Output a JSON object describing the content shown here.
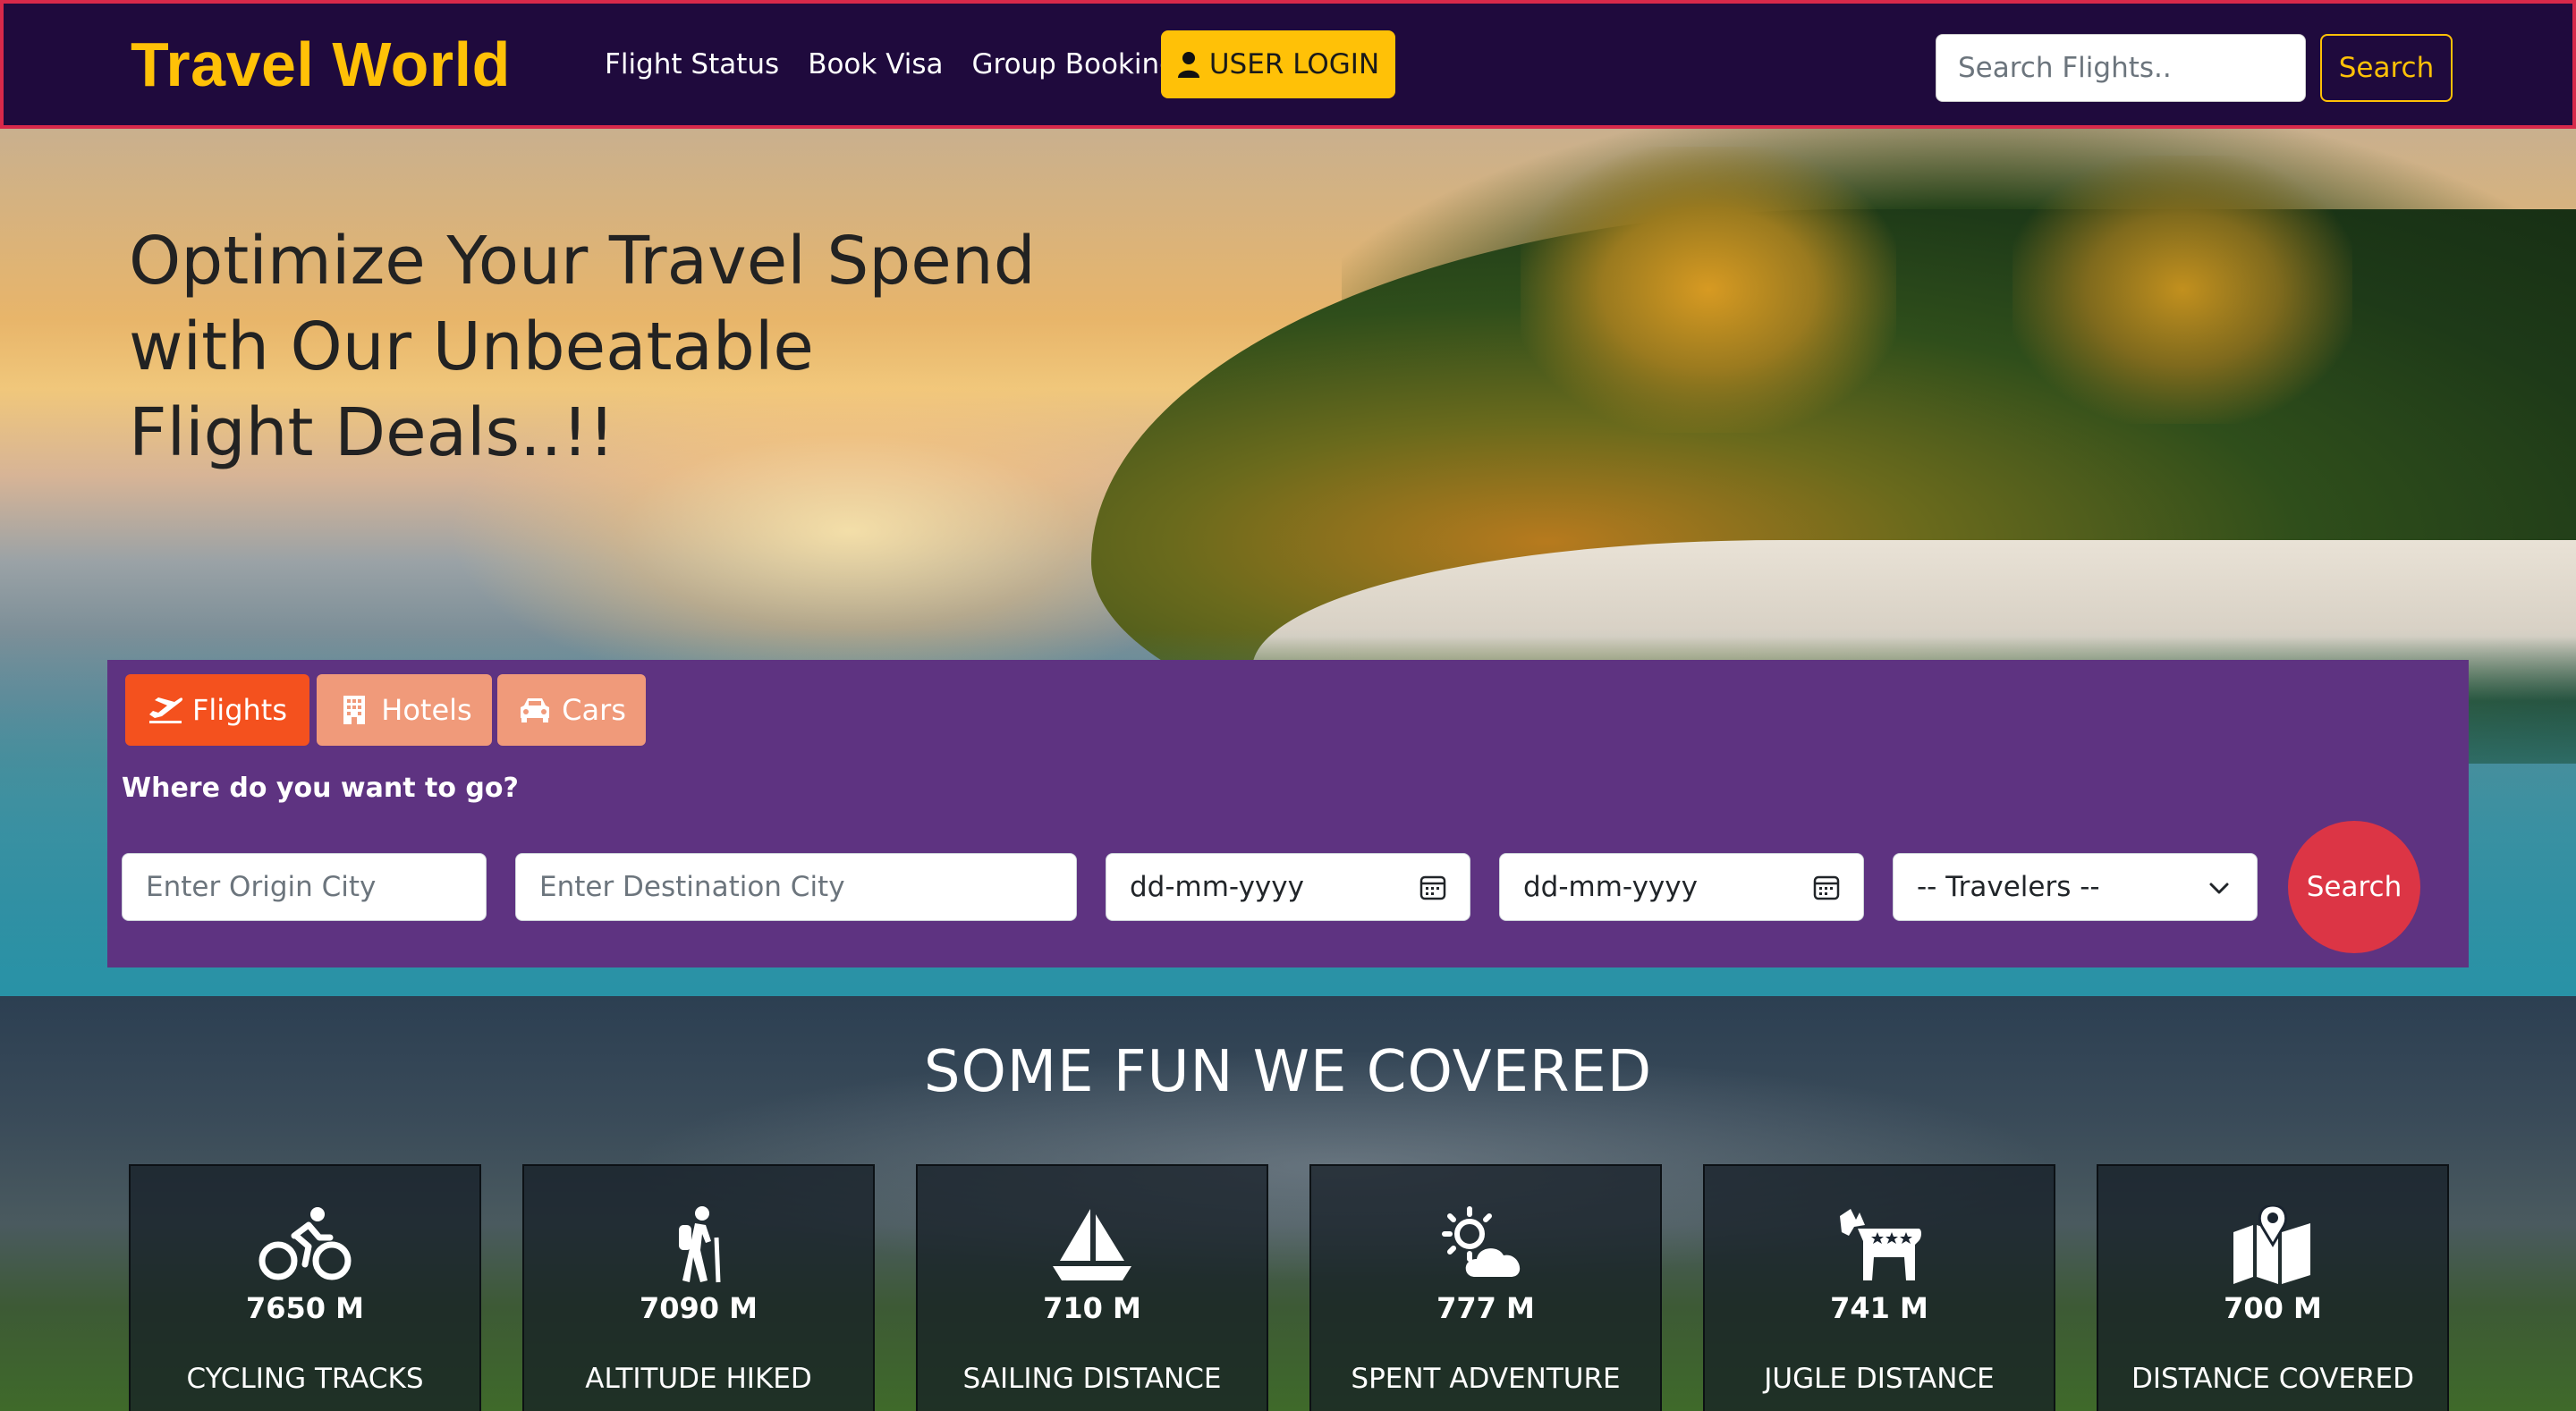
{
  "navbar": {
    "brand": "Travel World",
    "links": [
      "Flight Status",
      "Book Visa",
      "Group Booking"
    ],
    "login_label": "USER LOGIN",
    "search_placeholder": "Search Flights..",
    "search_button": "Search"
  },
  "hero": {
    "title_lines": [
      "Optimize Your Travel Spend",
      "with Our Unbeatable",
      "Flight Deals..!!"
    ]
  },
  "search": {
    "tabs": [
      {
        "label": "Flights",
        "icon": "plane-departure-icon",
        "active": true
      },
      {
        "label": "Hotels",
        "icon": "building-icon",
        "active": false
      },
      {
        "label": "Cars",
        "icon": "car-icon",
        "active": false
      }
    ],
    "prompt": "Where do you want to go?",
    "origin_placeholder": "Enter Origin City",
    "destination_placeholder": "Enter Destination City",
    "date1": "dd-mm-yyyy",
    "date2": "dd-mm-yyyy",
    "travelers": "-- Travelers --",
    "submit": "Search"
  },
  "stats": {
    "title": "SOME FUN WE COVERED",
    "cards": [
      {
        "icon": "bicycle-icon",
        "value": "7650 M",
        "label": "CYCLING TRACKS"
      },
      {
        "icon": "hiking-icon",
        "value": "7090 M",
        "label": "ALTITUDE HIKED"
      },
      {
        "icon": "sailboat-icon",
        "value": "710 M",
        "label": "SAILING DISTANCE"
      },
      {
        "icon": "sun-cloud-icon",
        "value": "777 M",
        "label": "SPENT ADVENTURE"
      },
      {
        "icon": "donkey-icon",
        "value": "741 M",
        "label": "JUGLE DISTANCE"
      },
      {
        "icon": "map-location-icon",
        "value": "700 M",
        "label": "DISTANCE COVERED"
      }
    ]
  },
  "colors": {
    "nav_bg": "#1f0a3d",
    "brand": "#ffc107",
    "search_panel": "#5e3381",
    "tab_active": "#f4511e",
    "tab_inactive": "#f09a7a",
    "submit": "#dc3545"
  }
}
